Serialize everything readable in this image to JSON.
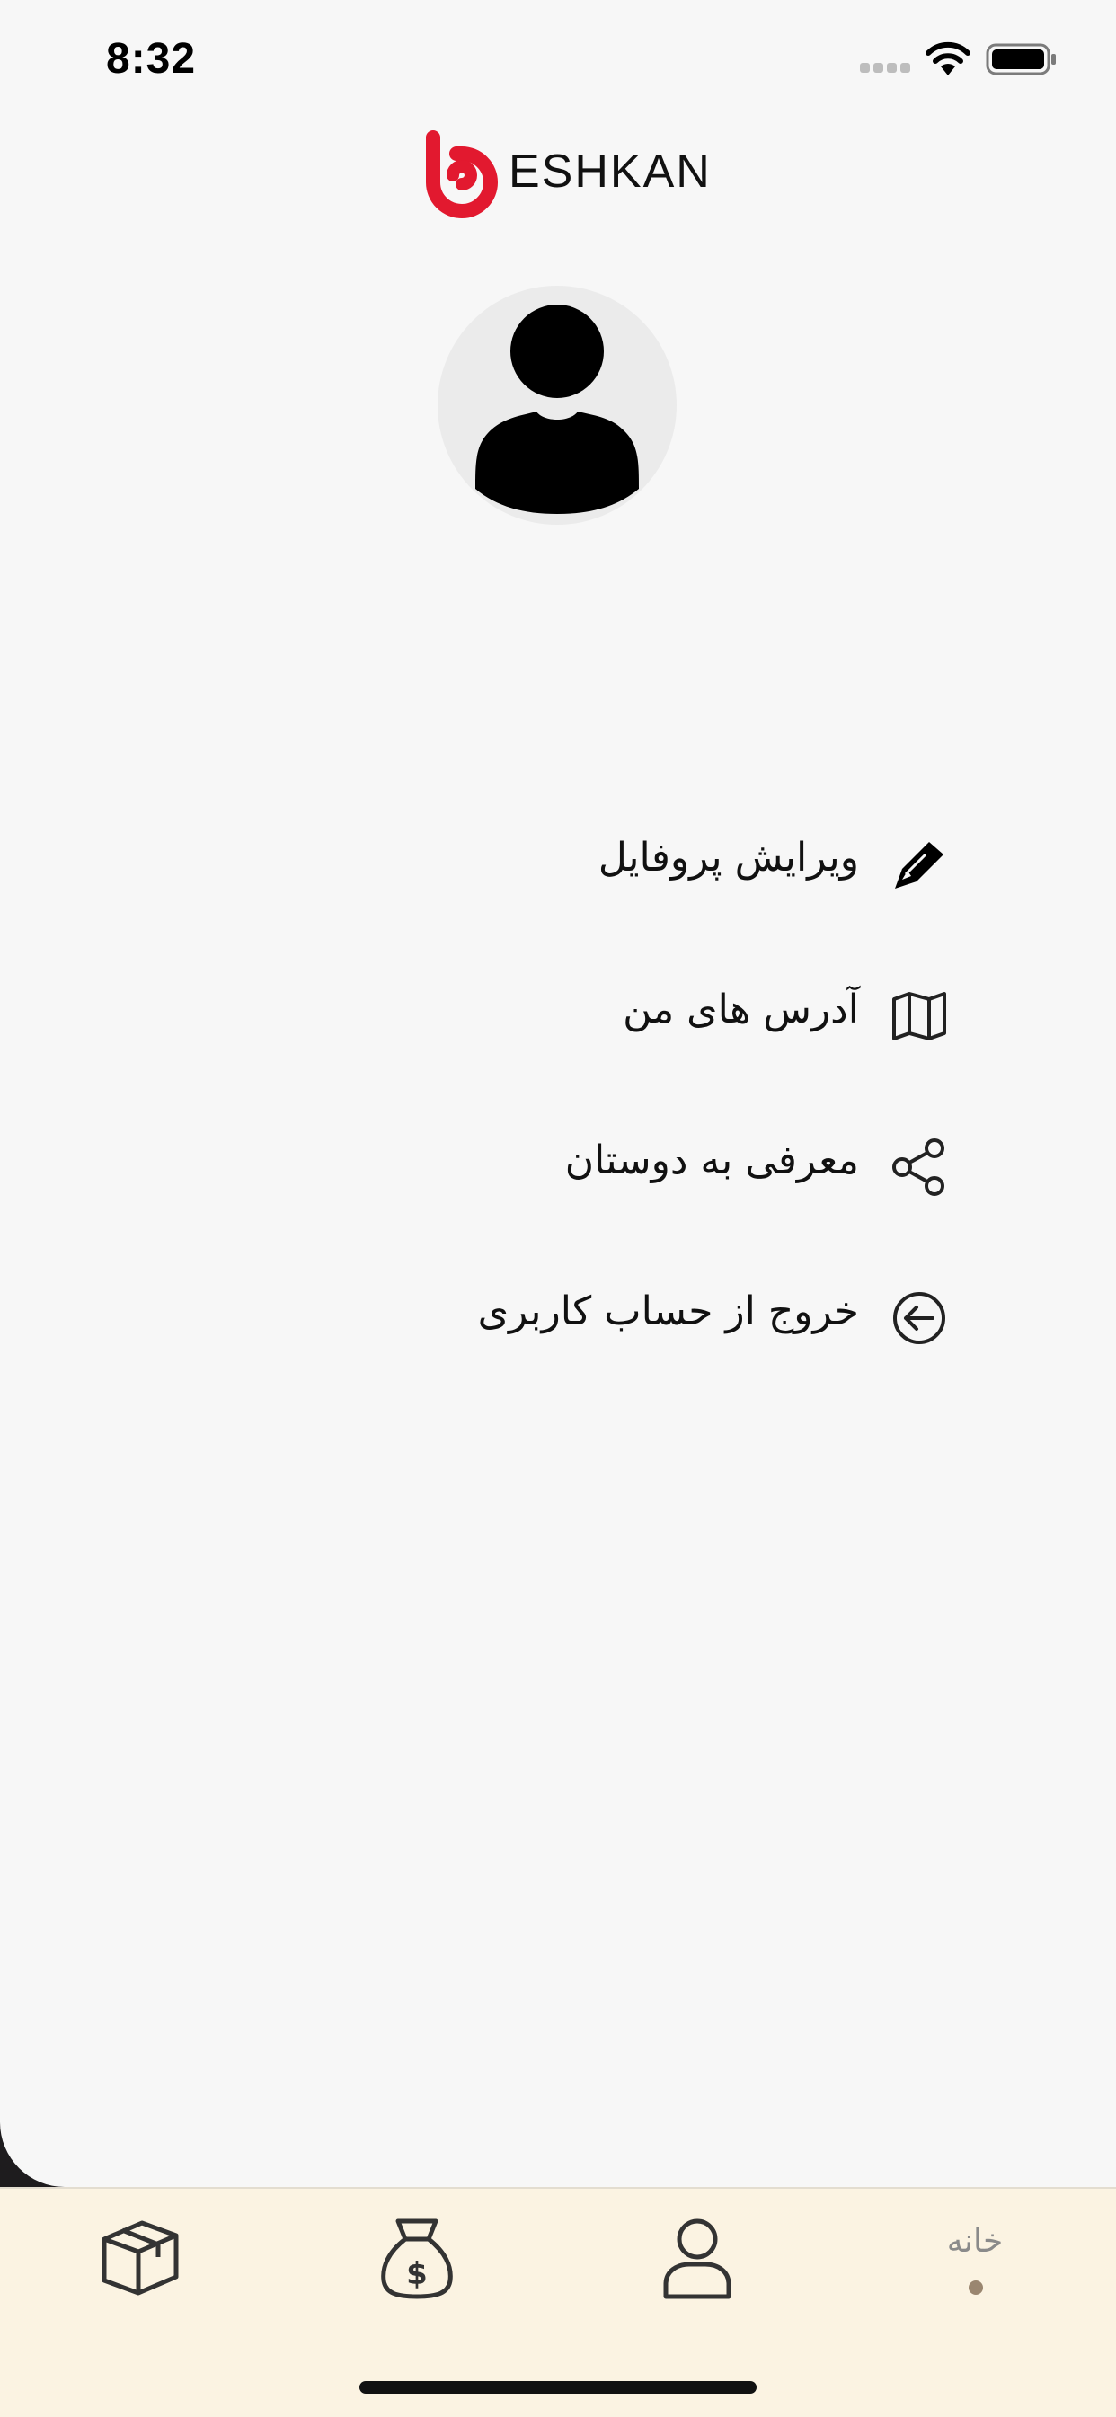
{
  "status_bar": {
    "time": "8:32"
  },
  "brand": {
    "name": "ESHKAN",
    "accent_color": "#e2192f"
  },
  "profile": {
    "avatar_icon": "user-silhouette-icon"
  },
  "menu": [
    {
      "label": "ویرایش پروفایل",
      "icon": "pencil-icon"
    },
    {
      "label": "آدرس های من",
      "icon": "map-icon"
    },
    {
      "label": "معرفی به دوستان",
      "icon": "share-icon"
    },
    {
      "label": "خروج از حساب کاربری",
      "icon": "logout-icon"
    }
  ],
  "tabbar": {
    "tabs": [
      {
        "icon": "box-icon"
      },
      {
        "icon": "money-bag-icon"
      },
      {
        "icon": "user-icon"
      },
      {
        "label": "خانه"
      }
    ],
    "background": "#fbf3e2"
  }
}
